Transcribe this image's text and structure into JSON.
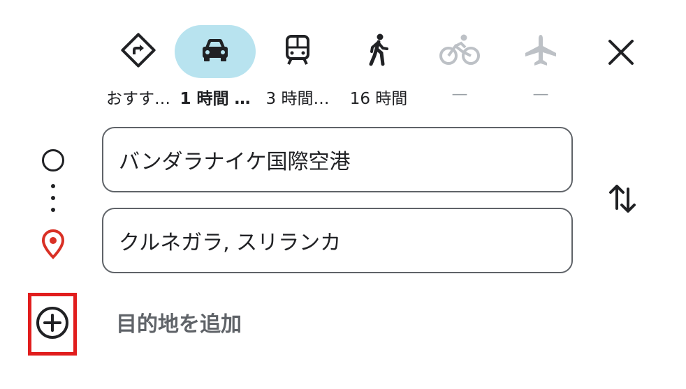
{
  "modes": [
    {
      "name": "recommended",
      "label": "おすす…",
      "icon": "directions-icon",
      "state": "normal"
    },
    {
      "name": "driving",
      "label": "1 時間 …",
      "icon": "car-icon",
      "state": "active"
    },
    {
      "name": "transit",
      "label": "3 時間…",
      "icon": "train-icon",
      "state": "normal"
    },
    {
      "name": "walking",
      "label": "16 時間",
      "icon": "walk-icon",
      "state": "normal"
    },
    {
      "name": "cycling",
      "label": "—",
      "icon": "bike-icon",
      "state": "disabled"
    },
    {
      "name": "flight",
      "label": "—",
      "icon": "airplane-icon",
      "state": "disabled"
    }
  ],
  "origin": {
    "value": "バンダラナイケ国際空港"
  },
  "destination": {
    "value": "クルネガラ, スリランカ"
  },
  "add_destination": {
    "label": "目的地を追加"
  },
  "colors": {
    "active_pill": "#b8e3ef",
    "pin": "#d93025",
    "highlight_box": "#e11d1d",
    "disabled": "#bdc1c6"
  }
}
